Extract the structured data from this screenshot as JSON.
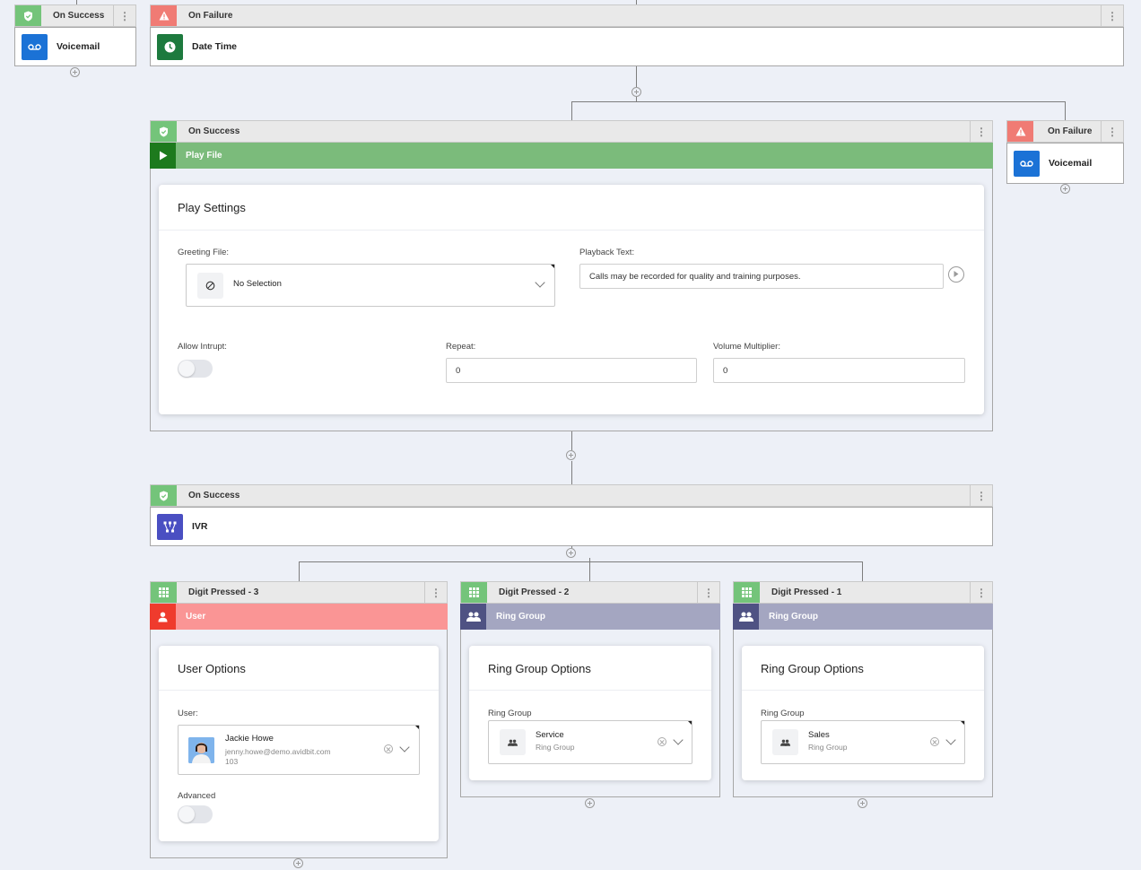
{
  "colors": {
    "success_green": "#74c47a",
    "failure_red": "#f07b74",
    "voicemail_blue": "#1b72d6",
    "datetime_green": "#1d7a3e",
    "playfile_band": "#7bbb7b",
    "playfile_icon": "#1d7a1d",
    "ivr_indigo": "#4a4fc2",
    "user_band": "#fa9595",
    "user_icon": "#ef3b2d",
    "ringgroup_band": "#a4a6c1",
    "ringgroup_icon": "#4f5283"
  },
  "top": {
    "left_branch": {
      "header": "On Success",
      "node_label": "Voicemail",
      "icon": "voicemail-icon"
    },
    "right_branch": {
      "header": "On Failure",
      "node_label": "Date Time",
      "icon": "clock-icon"
    }
  },
  "play_branch": {
    "header": "On Success",
    "band_label": "Play File",
    "card": {
      "title": "Play Settings",
      "greeting_label": "Greeting File:",
      "greeting_value": "No Selection",
      "playback_label": "Playback Text:",
      "playback_value": "Calls may be recorded for quality and training purposes.",
      "allow_interrupt_label": "Allow Intrupt:",
      "allow_interrupt_on": false,
      "repeat_label": "Repeat:",
      "repeat_value": "0",
      "volume_label": "Volume Multiplier:",
      "volume_value": "0"
    }
  },
  "failure_branch": {
    "header": "On Failure",
    "node_label": "Voicemail",
    "icon": "voicemail-icon"
  },
  "ivr_branch": {
    "header": "On Success",
    "node_label": "IVR",
    "icon": "ivr-icon"
  },
  "digits": [
    {
      "header": "Digit Pressed - 3",
      "band_label": "User",
      "card_title": "User Options",
      "field_label": "User:",
      "user_name": "Jackie Howe",
      "user_email": "jenny.howe@demo.avidbit.com",
      "user_ext": "103",
      "advanced_label": "Advanced",
      "advanced_on": false
    },
    {
      "header": "Digit Pressed - 2",
      "band_label": "Ring Group",
      "card_title": "Ring Group Options",
      "field_label": "Ring Group",
      "value_title": "Service",
      "value_sub": "Ring Group"
    },
    {
      "header": "Digit Pressed - 1",
      "band_label": "Ring Group",
      "card_title": "Ring Group Options",
      "field_label": "Ring Group",
      "value_title": "Sales",
      "value_sub": "Ring Group"
    }
  ],
  "menu_glyph": "⋮"
}
